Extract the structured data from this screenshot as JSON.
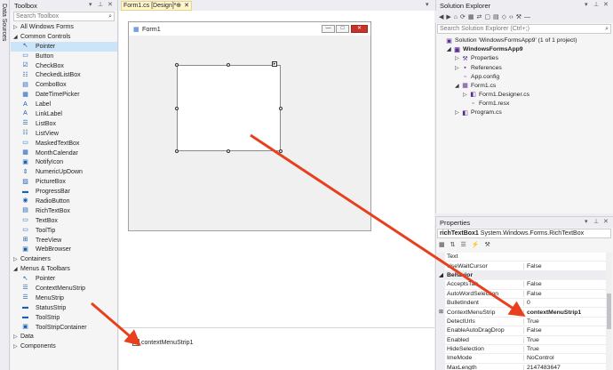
{
  "side_strip": {
    "label": "Data Sources"
  },
  "toolbox": {
    "title": "Toolbox",
    "controls": {
      "dropdown": "▾",
      "pin": "⊥",
      "close": "✕"
    },
    "search_placeholder": "Search Toolbox",
    "rows": [
      {
        "kind": "cat",
        "expanded": false,
        "label": "All Windows Forms"
      },
      {
        "kind": "cat",
        "expanded": true,
        "label": "Common Controls"
      },
      {
        "kind": "item",
        "icon": "↖",
        "label": "Pointer",
        "selected": true
      },
      {
        "kind": "item",
        "icon": "▭",
        "label": "Button"
      },
      {
        "kind": "item",
        "icon": "☑",
        "label": "CheckBox"
      },
      {
        "kind": "item",
        "icon": "☷",
        "label": "CheckedListBox"
      },
      {
        "kind": "item",
        "icon": "▤",
        "label": "ComboBox"
      },
      {
        "kind": "item",
        "icon": "▦",
        "label": "DateTimePicker"
      },
      {
        "kind": "item",
        "icon": "A",
        "label": "Label"
      },
      {
        "kind": "item",
        "icon": "A",
        "label": "LinkLabel"
      },
      {
        "kind": "item",
        "icon": "☰",
        "label": "ListBox"
      },
      {
        "kind": "item",
        "icon": "☷",
        "label": "ListView"
      },
      {
        "kind": "item",
        "icon": "▭",
        "label": "MaskedTextBox"
      },
      {
        "kind": "item",
        "icon": "▦",
        "label": "MonthCalendar"
      },
      {
        "kind": "item",
        "icon": "▣",
        "label": "NotifyIcon"
      },
      {
        "kind": "item",
        "icon": "⇕",
        "label": "NumericUpDown"
      },
      {
        "kind": "item",
        "icon": "▨",
        "label": "PictureBox"
      },
      {
        "kind": "item",
        "icon": "▬",
        "label": "ProgressBar"
      },
      {
        "kind": "item",
        "icon": "◉",
        "label": "RadioButton"
      },
      {
        "kind": "item",
        "icon": "▤",
        "label": "RichTextBox"
      },
      {
        "kind": "item",
        "icon": "▭",
        "label": "TextBox"
      },
      {
        "kind": "item",
        "icon": "▭",
        "label": "ToolTip"
      },
      {
        "kind": "item",
        "icon": "⊞",
        "label": "TreeView"
      },
      {
        "kind": "item",
        "icon": "▣",
        "label": "WebBrowser"
      },
      {
        "kind": "cat",
        "expanded": false,
        "label": "Containers"
      },
      {
        "kind": "cat",
        "expanded": true,
        "label": "Menus & Toolbars"
      },
      {
        "kind": "item",
        "icon": "↖",
        "label": "Pointer"
      },
      {
        "kind": "item",
        "icon": "☰",
        "label": "ContextMenuStrip"
      },
      {
        "kind": "item",
        "icon": "☰",
        "label": "MenuStrip"
      },
      {
        "kind": "item",
        "icon": "▬",
        "label": "StatusStrip"
      },
      {
        "kind": "item",
        "icon": "▬",
        "label": "ToolStrip"
      },
      {
        "kind": "item",
        "icon": "▣",
        "label": "ToolStripContainer"
      },
      {
        "kind": "cat",
        "expanded": false,
        "label": "Data"
      },
      {
        "kind": "cat",
        "expanded": false,
        "label": "Components"
      }
    ]
  },
  "document": {
    "tab_label": "Form1.cs [Design]*",
    "tab_pin": "⊕",
    "tab_close": "✕",
    "tab_overflow": "▾",
    "form": {
      "title": "Form1",
      "icon": "▦",
      "buttons": {
        "minimize": "—",
        "maximize": "□",
        "close": "✕"
      }
    },
    "smart_tag": "▸",
    "tray_component": "contextMenuStrip1"
  },
  "solution_explorer": {
    "title": "Solution Explorer",
    "controls": {
      "dropdown": "▾",
      "pin": "⊥",
      "close": "✕"
    },
    "toolbar_icons": [
      "◀",
      "▶",
      "⌂",
      "⟳",
      "▦",
      "⇄",
      "▢",
      "▤",
      "◇",
      "‹›",
      "⚒",
      "—"
    ],
    "search_placeholder": "Search Solution Explorer (Ctrl+;)",
    "rows": [
      {
        "indent": 0,
        "tri": "",
        "icon": "▣",
        "label": "Solution 'WindowsFormsApp9' (1 of 1 project)",
        "bold": false
      },
      {
        "indent": 1,
        "tri": "◢",
        "icon": "▣",
        "label": "WindowsFormsApp9",
        "bold": true
      },
      {
        "indent": 2,
        "tri": "▷",
        "icon": "⚒",
        "label": "Properties",
        "bold": false
      },
      {
        "indent": 2,
        "tri": "▷",
        "icon": "▪",
        "label": "References",
        "bold": false
      },
      {
        "indent": 2,
        "tri": "",
        "icon": "▫",
        "label": "App.config",
        "bold": false
      },
      {
        "indent": 2,
        "tri": "◢",
        "icon": "▦",
        "label": "Form1.cs",
        "bold": false
      },
      {
        "indent": 3,
        "tri": "▷",
        "icon": "◧",
        "label": "Form1.Designer.cs",
        "bold": false
      },
      {
        "indent": 3,
        "tri": "",
        "icon": "▫",
        "label": "Form1.resx",
        "bold": false
      },
      {
        "indent": 2,
        "tri": "▷",
        "icon": "◧",
        "label": "Program.cs",
        "bold": false
      }
    ]
  },
  "properties": {
    "title": "Properties",
    "controls": {
      "dropdown": "▾",
      "pin": "⊥",
      "close": "✕"
    },
    "object_name": "richTextBox1",
    "object_type": "System.Windows.Forms.RichTextBox",
    "toolbar_icons": [
      "▦",
      "⇅",
      "☰",
      "⚡",
      "⚒"
    ],
    "rows": [
      {
        "kind": "prop",
        "gut": "",
        "name": "Text",
        "value": "",
        "bold": false
      },
      {
        "kind": "prop",
        "gut": "",
        "name": "UseWaitCursor",
        "value": "False",
        "bold": false
      },
      {
        "kind": "cat",
        "gut": "◢",
        "name": "Behavior"
      },
      {
        "kind": "prop",
        "gut": "",
        "name": "AcceptsTab",
        "value": "False",
        "bold": false
      },
      {
        "kind": "prop",
        "gut": "",
        "name": "AutoWordSelection",
        "value": "False",
        "bold": false
      },
      {
        "kind": "prop",
        "gut": "",
        "name": "BulletIndent",
        "value": "0",
        "bold": false
      },
      {
        "kind": "prop",
        "gut": "⊞",
        "name": "ContextMenuStrip",
        "value": "contextMenuStrip1",
        "bold": true
      },
      {
        "kind": "prop",
        "gut": "",
        "name": "DetectUrls",
        "value": "True",
        "bold": false
      },
      {
        "kind": "prop",
        "gut": "",
        "name": "EnableAutoDragDrop",
        "value": "False",
        "bold": false
      },
      {
        "kind": "prop",
        "gut": "",
        "name": "Enabled",
        "value": "True",
        "bold": false
      },
      {
        "kind": "prop",
        "gut": "",
        "name": "HideSelection",
        "value": "True",
        "bold": false
      },
      {
        "kind": "prop",
        "gut": "",
        "name": "ImeMode",
        "value": "NoControl",
        "bold": false
      },
      {
        "kind": "prop",
        "gut": "",
        "name": "MaxLength",
        "value": "2147483647",
        "bold": false
      }
    ]
  },
  "colors": {
    "selection": "#cce4f7",
    "tab_active": "#fff6cc",
    "annotation_arrow": "#e8401c",
    "form_close": "#c7322a"
  }
}
